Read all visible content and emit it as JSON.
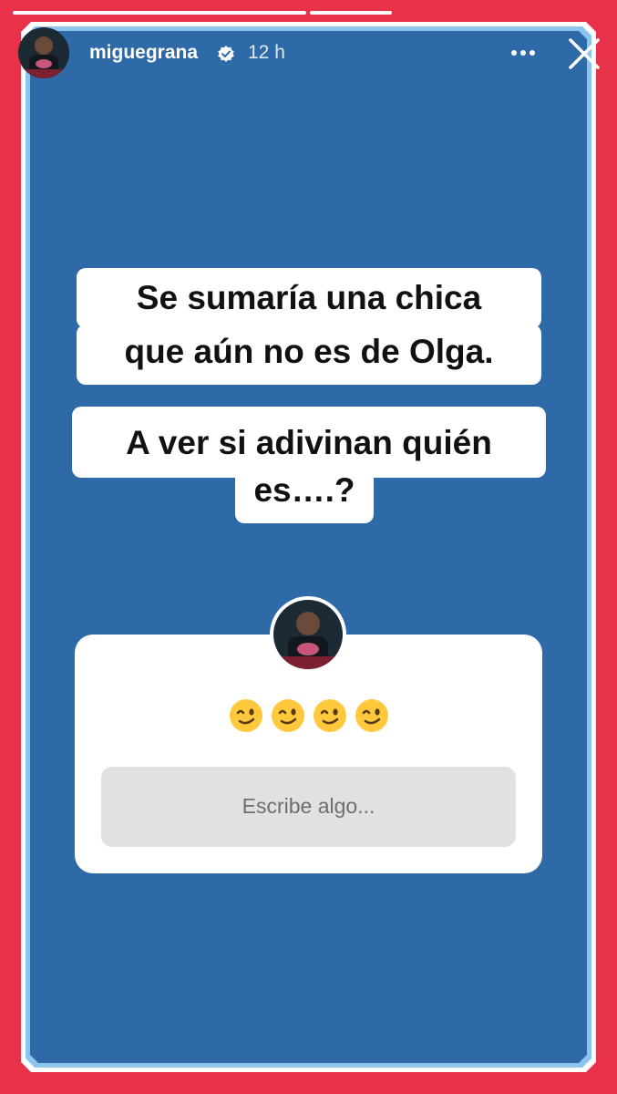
{
  "story": {
    "progress": [
      {
        "fraction": 1.0
      },
      {
        "fraction": 1.0
      }
    ],
    "header": {
      "username": "miguegrana",
      "verified": true,
      "time_ago": "12 h",
      "more_icon": "more-horizontal-icon",
      "close_icon": "close-icon"
    },
    "text_lines": [
      {
        "line1": "Se sumaría una chica",
        "line2": "que aún no es de Olga."
      },
      {
        "line1": "A ver si adivinan quién",
        "line2": "es….?"
      }
    ],
    "question_sticker": {
      "prompt": "😉😉😉😉",
      "reply_placeholder": "Escribe algo..."
    },
    "colors": {
      "frame": "#e8324a",
      "background": "#2e69a8",
      "border_accent": "#5aa9e6"
    }
  }
}
